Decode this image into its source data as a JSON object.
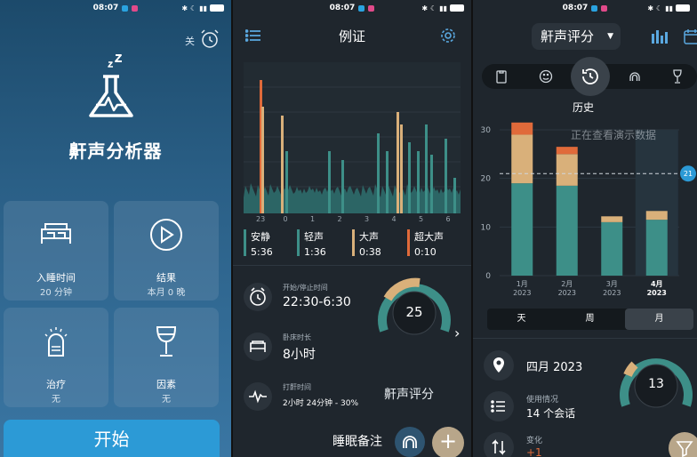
{
  "status": {
    "time": "08:07"
  },
  "panel1": {
    "alarm_label": "关",
    "title": "鼾声分析器",
    "tiles": [
      {
        "label": "入睡时间",
        "value": "20 分钟"
      },
      {
        "label": "结果",
        "value": "本月 0 晚"
      },
      {
        "label": "治疗",
        "value": "无"
      },
      {
        "label": "因素",
        "value": "无"
      }
    ],
    "start_label": "开始"
  },
  "panel2": {
    "title": "例证",
    "x_ticks": [
      "23",
      "0",
      "1",
      "2",
      "3",
      "4",
      "5",
      "6"
    ],
    "legend": [
      {
        "name": "安静",
        "value": "5:36",
        "color": "#3d8f88"
      },
      {
        "name": "轻声",
        "value": "1:36",
        "color": "#3d8f88"
      },
      {
        "name": "大声",
        "value": "0:38",
        "color": "#d9b07a"
      },
      {
        "name": "超大声",
        "value": "0:10",
        "color": "#e06a3a"
      }
    ],
    "rows": [
      {
        "label": "开始/停止时间",
        "value": "22:30-6:30"
      },
      {
        "label": "卧床时长",
        "value": "8小时"
      },
      {
        "label": "打鼾时间",
        "value": "2小时 24分钟 - 30%"
      }
    ],
    "score": "25",
    "score_label": "鼾声评分",
    "notes_label": "睡眠备注",
    "add_label": "+"
  },
  "panel3": {
    "selector_label": "鼾声评分",
    "history_label": "历史",
    "tabs": [
      "天",
      "周",
      "月"
    ],
    "active_tab": "月",
    "rows": [
      {
        "label": "",
        "value": "四月 2023"
      },
      {
        "label": "使用情况",
        "value": "14 个会话"
      },
      {
        "label": "变化",
        "value": "+1"
      }
    ],
    "score": "13",
    "chart_data": {
      "type": "bar",
      "title": "",
      "watermark": "正在查看演示数据",
      "categories": [
        "1月\n2023",
        "2月\n2023",
        "3月\n2023",
        "4月\n2023"
      ],
      "ylim": [
        0,
        30
      ],
      "yticks": [
        0,
        10,
        20,
        30
      ],
      "reference_value": 21,
      "series": [
        {
          "values": [
            19,
            18.5,
            11,
            11.5
          ],
          "color": "#3d8f88"
        },
        {
          "values": [
            10,
            6.5,
            1.2,
            1.8
          ],
          "color": "#d9b07a"
        },
        {
          "values": [
            2.5,
            1.5,
            0,
            0
          ],
          "color": "#e06a3a"
        }
      ]
    }
  }
}
